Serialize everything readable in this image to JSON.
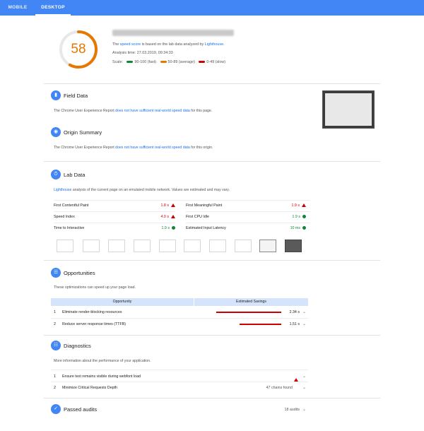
{
  "tabs": {
    "mobile": "MOBILE",
    "desktop": "DESKTOP"
  },
  "summary": {
    "score": "58",
    "score_value": 58,
    "score_color": "#e67700",
    "line1_pre": "The ",
    "line1_link": "speed score",
    "line1_mid": " is based on the lab data analyzed by ",
    "line1_link2": "Lighthouse",
    "line1_post": ".",
    "analysis_time": "Analysis time: 27.03.2019, 09:34:33",
    "scale_label": "Scale:",
    "scale_fast": "90-100 (fast)",
    "scale_average": "50-89 (average)",
    "scale_slow": "0-49 (slow)",
    "colors": {
      "fast": "#178239",
      "average": "#e67700",
      "slow": "#cc0000"
    }
  },
  "field_data": {
    "title": "Field Data",
    "text_pre": "The Chrome User Experience Report ",
    "text_link": "does not have sufficient real-world speed data",
    "text_post": " for this page."
  },
  "origin_summary": {
    "title": "Origin Summary",
    "text_pre": "The Chrome User Experience Report ",
    "text_link": "does not have sufficient real-world speed data",
    "text_post": " for this origin."
  },
  "lab_data": {
    "title": "Lab Data",
    "intro_link": "Lighthouse",
    "intro_text": " analysis of the current page on an emulated mobile network. Values are estimated and may vary.",
    "metrics": [
      {
        "label": "First Contentful Paint",
        "value": "1.8 s"
      },
      {
        "label": "First Meaningful Paint",
        "value": "1.9 s"
      },
      {
        "label": "Speed Index",
        "value": "4.0 s"
      },
      {
        "label": "First CPU Idle",
        "value": "1.9 s"
      },
      {
        "label": "Time to Interactive",
        "value": "1.9 s"
      },
      {
        "label": "Estimated Input Latency",
        "value": "10 ms"
      }
    ]
  },
  "opportunities": {
    "title": "Opportunities",
    "intro": "These optimizations can speed up your page load.",
    "col_opportunity": "Opportunity",
    "col_savings": "Estimated Savings",
    "rows": [
      {
        "num": "1",
        "label": "Eliminate render-blocking resources",
        "value": "2.34 s",
        "fraction": 0.98
      },
      {
        "num": "2",
        "label": "Reduce server response times (TTFB)",
        "value": "1.51 s",
        "fraction": 0.63
      }
    ]
  },
  "diagnostics": {
    "title": "Diagnostics",
    "intro": "More information about the performance of your application.",
    "rows": [
      {
        "num": "1",
        "label": "Ensure text remains visible during webfont load",
        "value": ""
      },
      {
        "num": "2",
        "label": "Minimize Critical Requests Depth",
        "value": "47 chains found"
      }
    ]
  },
  "passed": {
    "title": "Passed audits",
    "count": "18 audits"
  }
}
